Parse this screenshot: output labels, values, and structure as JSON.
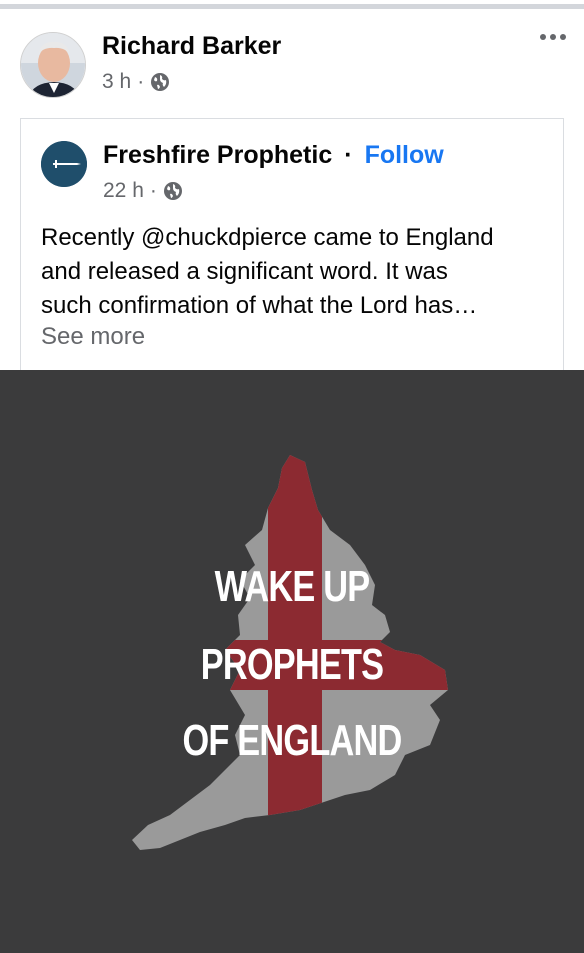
{
  "post": {
    "author": "Richard Barker",
    "time": "3 h",
    "meta_sep": "·",
    "privacy_icon": "globe-icon",
    "more_icon": "more-dots-icon"
  },
  "shared": {
    "page_name": "Freshfire Prophetic",
    "dot": "·",
    "follow_label": "Follow",
    "time": "22 h",
    "meta_sep": "·",
    "text_lines": [
      "Recently @chuckdpierce came to England",
      "and released a significant word. It was",
      "such confirmation of what the Lord has…"
    ],
    "see_more": "See more"
  },
  "image": {
    "lines": [
      "WAKE UP",
      "PROPHETS",
      "OF ENGLAND"
    ],
    "colors": {
      "background": "#3b3b3c",
      "map": "#9a9a9a",
      "cross": "#8c2a31"
    }
  },
  "colors": {
    "link": "#1877f2",
    "secondary_text": "#65676b"
  }
}
